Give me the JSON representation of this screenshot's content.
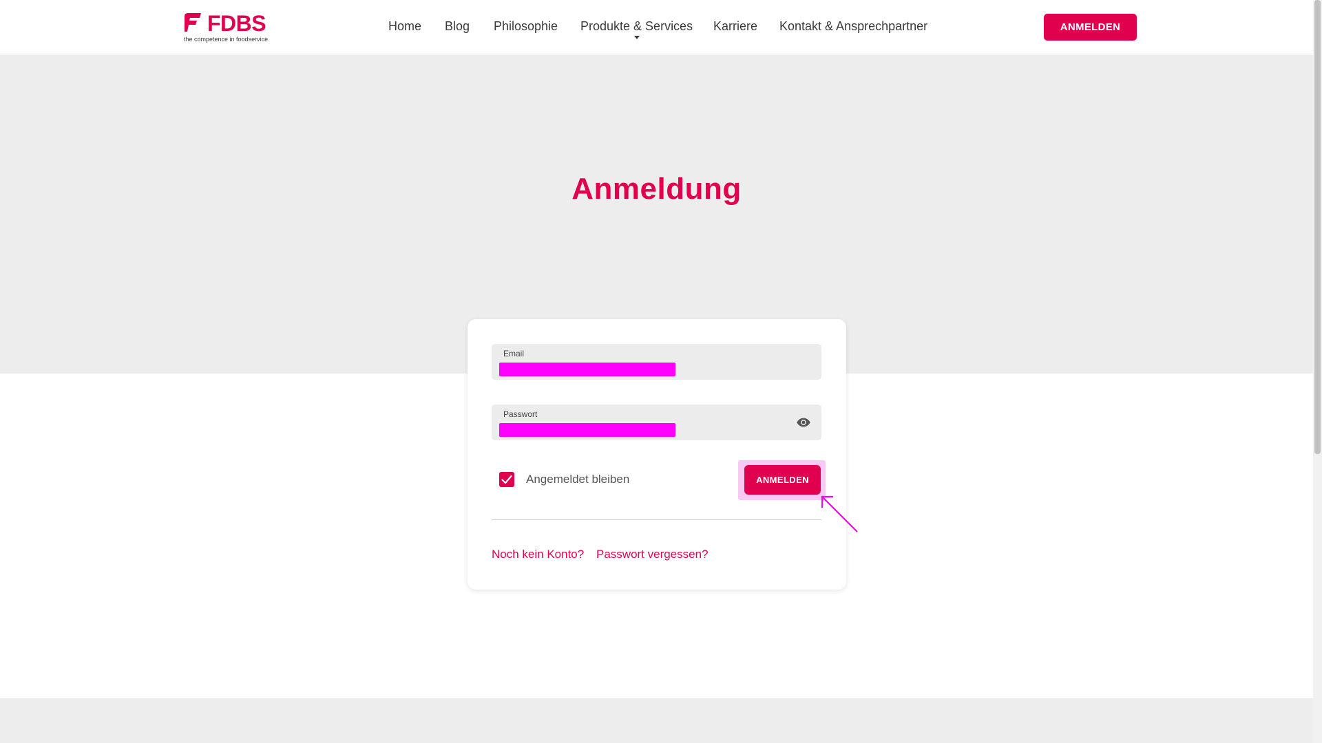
{
  "brand": {
    "name": "FDBS",
    "tagline": "the competence in foodservice",
    "accent_color": "#e0004d"
  },
  "nav": {
    "items": [
      {
        "label": "Home"
      },
      {
        "label": "Blog"
      },
      {
        "label": "Philosophie"
      },
      {
        "label": "Produkte & Services"
      },
      {
        "label": "Karriere"
      },
      {
        "label": "Kontakt & Ansprechpartner"
      }
    ],
    "login_button": "ANMELDEN"
  },
  "page": {
    "title": "Anmeldung"
  },
  "form": {
    "email_label": "Email",
    "email_value": "",
    "password_label": "Passwort",
    "password_value": "",
    "remember_label": "Angemeldet bleiben",
    "remember_checked": true,
    "submit_label": "ANMELDEN",
    "register_link": "Noch kein Konto?",
    "forgot_link": "Passwort vergessen?"
  },
  "icons": {
    "password_toggle": "eye-icon",
    "checkbox": "check-icon",
    "submenu": "caret-down-icon"
  },
  "annotation": {
    "highlight_color": "#ff00ff",
    "redaction_color": "#ff00ff"
  }
}
